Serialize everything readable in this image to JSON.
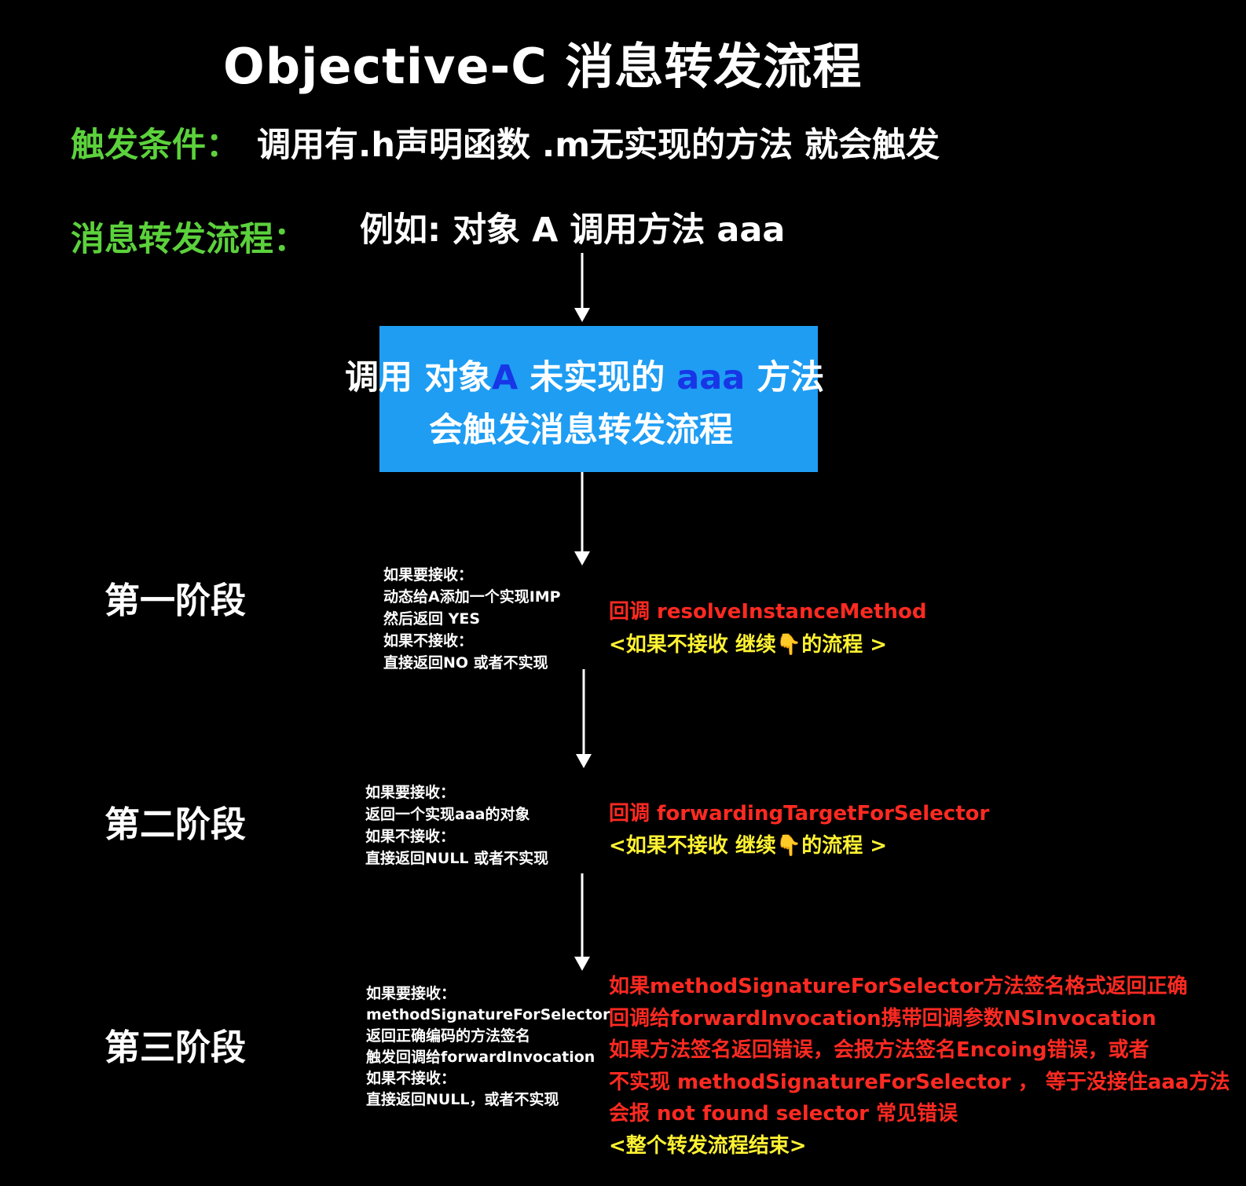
{
  "title": "Objective-C 消息转发流程",
  "trigger": {
    "label": "触发条件：",
    "text": "调用有.h声明函数 .m无实现的方法 就会触发"
  },
  "flow": {
    "label": "消息转发流程：",
    "example": "例如: 对象 A 调用方法 aaa"
  },
  "box": {
    "line1_a": "调用 对象",
    "line1_b": "A",
    "line1_c": " 未实现的 ",
    "line1_d": "aaa",
    "line1_e": " 方法",
    "line2": "会触发消息转发流程"
  },
  "stages": {
    "s1": {
      "label": "第一阶段",
      "notes": [
        "如果要接收：",
        "动态给A添加一个实现IMP",
        "然后返回 YES",
        "如果不接收：",
        "直接返回NO 或者不实现"
      ],
      "callback": "回调 resolveInstanceMethod",
      "continue": "<如果不接收 继续👇的流程 >"
    },
    "s2": {
      "label": "第二阶段",
      "notes": [
        "如果要接收：",
        "返回一个实现aaa的对象",
        "如果不接收：",
        "直接返回NULL 或者不实现"
      ],
      "callback": "回调 forwardingTargetForSelector",
      "continue": "<如果不接收 继续👇的流程 >"
    },
    "s3": {
      "label": "第三阶段",
      "notes": [
        "如果要接收：",
        "methodSignatureForSelector",
        "返回正确编码的方法签名",
        "触发回调给forwardInvocation",
        "如果不接收：",
        "直接返回NULL，或者不实现"
      ],
      "callback_lines": [
        "如果methodSignatureForSelector方法签名格式返回正确",
        "回调给forwardInvocation携带回调参数NSInvocation",
        "如果方法签名返回错误，会报方法签名Encoing错误，或者",
        "不实现 methodSignatureForSelector ， 等于没接住aaa方法",
        "会报 not found selector 常见错误"
      ],
      "end": "<整个转发流程结束>"
    }
  }
}
